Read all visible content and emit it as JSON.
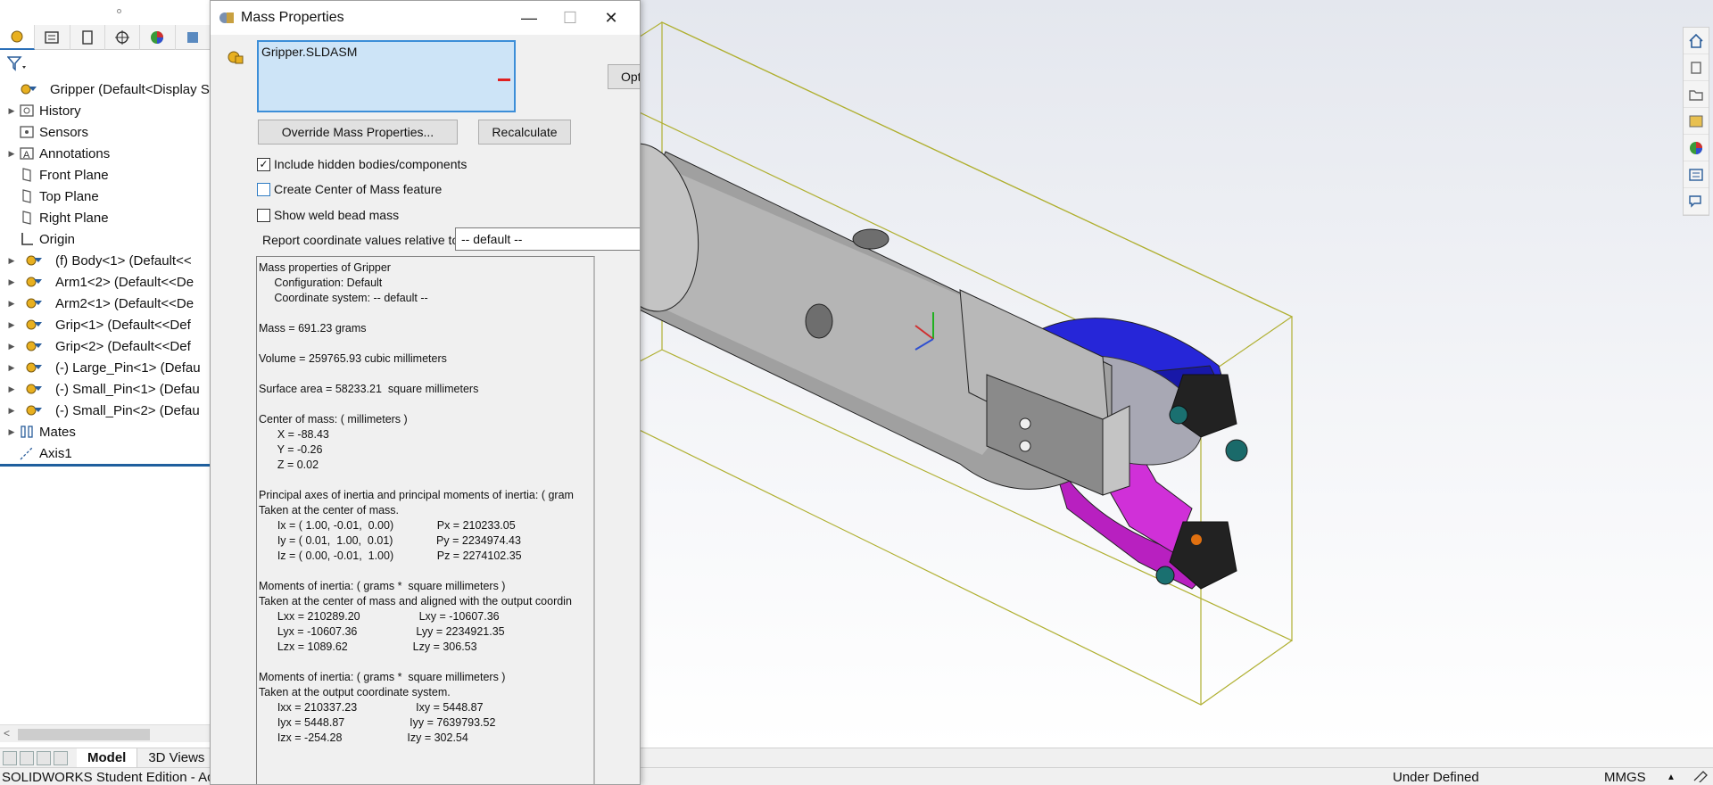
{
  "feature_manager": {
    "filter_icon": "filter-icon",
    "tabs": [
      "feature-manager-tab",
      "property-manager-tab",
      "configuration-manager-tab",
      "dimxpert-tab",
      "display-manager-tab",
      "cam-tab"
    ],
    "tree": [
      {
        "label": "Gripper  (Default<Display S",
        "icon": "assembly-icon",
        "expand": "",
        "indent": 0
      },
      {
        "label": "History",
        "icon": "history-icon",
        "expand": "▶",
        "indent": 1
      },
      {
        "label": "Sensors",
        "icon": "sensors-icon",
        "expand": "",
        "indent": 1
      },
      {
        "label": "Annotations",
        "icon": "annotations-icon",
        "expand": "▶",
        "indent": 1
      },
      {
        "label": "Front Plane",
        "icon": "plane-icon",
        "expand": "",
        "indent": 1
      },
      {
        "label": "Top Plane",
        "icon": "plane-icon",
        "expand": "",
        "indent": 1
      },
      {
        "label": "Right Plane",
        "icon": "plane-icon",
        "expand": "",
        "indent": 1
      },
      {
        "label": "Origin",
        "icon": "origin-icon",
        "expand": "",
        "indent": 1
      },
      {
        "label": "(f) Body<1> (Default<<",
        "icon": "part-icon",
        "expand": "▶",
        "indent": 1
      },
      {
        "label": "Arm1<2> (Default<<De",
        "icon": "part-icon",
        "expand": "▶",
        "indent": 1
      },
      {
        "label": "Arm2<1> (Default<<De",
        "icon": "part-icon",
        "expand": "▶",
        "indent": 1
      },
      {
        "label": "Grip<1> (Default<<Def",
        "icon": "part-icon",
        "expand": "▶",
        "indent": 1
      },
      {
        "label": "Grip<2> (Default<<Def",
        "icon": "part-icon",
        "expand": "▶",
        "indent": 1
      },
      {
        "label": "(-) Large_Pin<1> (Defau",
        "icon": "part-icon",
        "expand": "▶",
        "indent": 1
      },
      {
        "label": "(-) Small_Pin<1> (Defau",
        "icon": "part-icon",
        "expand": "▶",
        "indent": 1
      },
      {
        "label": "(-) Small_Pin<2> (Defau",
        "icon": "part-icon",
        "expand": "▶",
        "indent": 1
      },
      {
        "label": "Mates",
        "icon": "mates-icon",
        "expand": "▶",
        "indent": 1
      },
      {
        "label": "Axis1",
        "icon": "axis-icon",
        "expand": "",
        "indent": 1
      }
    ]
  },
  "bottom_tabs": [
    "Model",
    "3D Views"
  ],
  "statusbar": {
    "left": "SOLIDWORKS Student Edition - Aca",
    "state": "Under Defined",
    "units": "MMGS",
    "units_arrow": "▲"
  },
  "dialog": {
    "title": "Mass Properties",
    "controls": {
      "minimize": "—",
      "maximize": "☐",
      "close": "✕"
    },
    "selection": "Gripper.SLDASM",
    "options_label": "Opt",
    "override_label": "Override Mass Properties...",
    "recalc_label": "Recalculate",
    "include_hidden": {
      "label": "Include hidden bodies/components",
      "checked": true,
      "mark": "✓"
    },
    "create_com": {
      "label": "Create Center of Mass feature",
      "checked": false
    },
    "weld_bead": {
      "label": "Show weld bead mass",
      "checked": false
    },
    "coord_label": "Report coordinate values relative to:",
    "coord_value": "-- default --",
    "results": [
      "Mass properties of Gripper",
      "     Configuration: Default",
      "     Coordinate system: -- default --",
      "",
      "Mass = 691.23 grams",
      "",
      "Volume = 259765.93 cubic millimeters",
      "",
      "Surface area = 58233.21  square millimeters",
      "",
      "Center of mass: ( millimeters )",
      "      X = -88.43",
      "      Y = -0.26",
      "      Z = 0.02",
      "",
      "Principal axes of inertia and principal moments of inertia: ( gram",
      "Taken at the center of mass.",
      "      Ix = ( 1.00, -0.01,  0.00)              Px = 210233.05",
      "      Iy = ( 0.01,  1.00,  0.01)              Py = 2234974.43",
      "      Iz = ( 0.00, -0.01,  1.00)              Pz = 2274102.35",
      "",
      "Moments of inertia: ( grams *  square millimeters )",
      "Taken at the center of mass and aligned with the output coordin",
      "      Lxx = 210289.20                   Lxy = -10607.36",
      "      Lyx = -10607.36                   Lyy = 2234921.35",
      "      Lzx = 1089.62                     Lzy = 306.53",
      "",
      "Moments of inertia: ( grams *  square millimeters )",
      "Taken at the output coordinate system.",
      "      Ixx = 210337.23                   Ixy = 5448.87",
      "      Iyx = 5448.87                     Iyy = 7639793.52",
      "      Izx = -254.28                     Izy = 302.54"
    ]
  },
  "colors": {
    "accent": "#2a6fb8",
    "part_blue": "#1a1ad0",
    "part_magenta": "#c020c8",
    "body_grey": "#a8a8a8",
    "bbox": "#b5b52a"
  },
  "right_toolbar": [
    "home-icon",
    "parts-icon",
    "folder-icon",
    "view-palette-icon",
    "appearance-icon",
    "properties-icon",
    "forum-icon"
  ]
}
